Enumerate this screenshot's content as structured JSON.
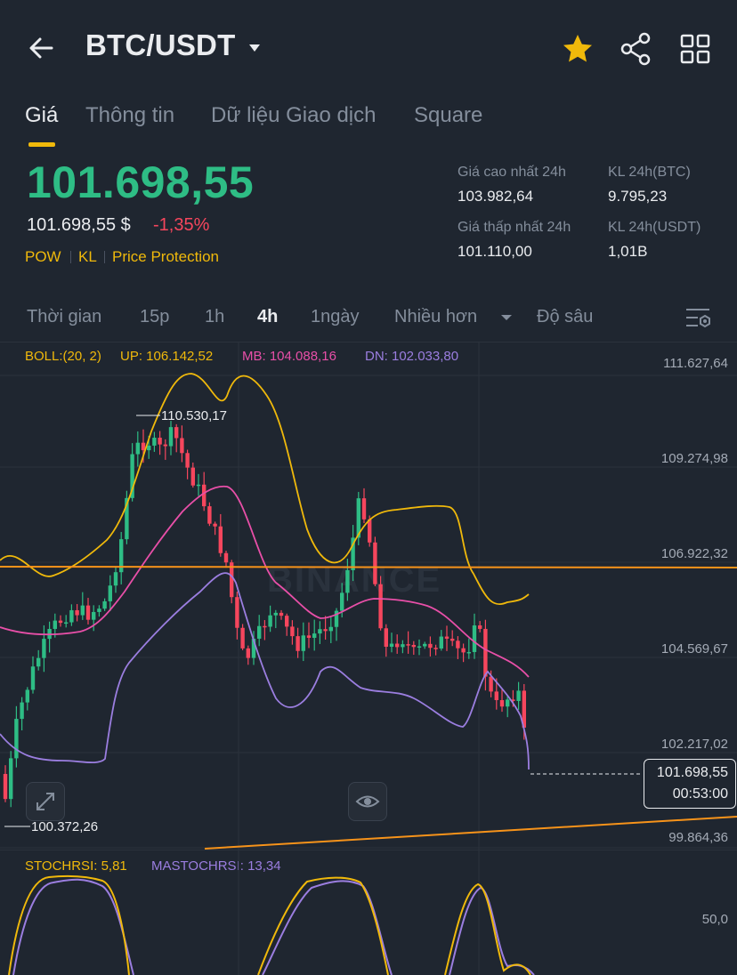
{
  "header": {
    "pair": "BTC/USDT",
    "icons": [
      "back-arrow-icon",
      "chevron-down-icon",
      "star-icon",
      "share-icon",
      "grid-icon"
    ],
    "colors": {
      "star": "#f0b90b"
    }
  },
  "tabs": [
    "Giá",
    "Thông tin",
    "Dữ liệu Giao dịch",
    "Square"
  ],
  "price": {
    "last": "101.698,55",
    "usd": "101.698,55 $",
    "change": "-1,35%",
    "tags": [
      "POW",
      "KL",
      "Price Protection"
    ],
    "colors": {
      "up": "#2ebd85",
      "down": "#f6465d",
      "tag": "#f0b90b"
    }
  },
  "stats": {
    "high_label": "Giá cao nhất 24h",
    "high_value": "103.982,64",
    "low_label": "Giá thấp nhất 24h",
    "low_value": "101.110,00",
    "vol_btc_label": "KL 24h(BTC)",
    "vol_btc_value": "9.795,23",
    "vol_usdt_label": "KL 24h(USDT)",
    "vol_usdt_value": "1,01B"
  },
  "intervals": {
    "items": [
      "Thời gian",
      "15p",
      "1h",
      "4h",
      "1ngày",
      "Nhiều hơn",
      "Độ sâu"
    ],
    "selected": "4h",
    "settings_icon": "chart-settings-icon"
  },
  "chart": {
    "boll_legend": {
      "label": "BOLL:(20, 2)",
      "up": "UP: 106.142,52",
      "mb": "MB: 104.088,16",
      "dn": "DN: 102.033,80"
    },
    "y_labels": [
      "111.627,64",
      "109.274,98",
      "106.922,32",
      "104.569,67",
      "102.217,02",
      "99.864,36"
    ],
    "max_annotation": "110.530,17",
    "min_annotation": "100.372,26",
    "last_price": "101.698,55",
    "countdown": "00:53:00",
    "watermark": "BINANCE",
    "icons": [
      "expand-icon",
      "eye-icon"
    ],
    "colors": {
      "up": "#2ebd85",
      "down": "#f6465d",
      "boll_up": "#f0b90b",
      "boll_mb": "#e84fa8",
      "boll_dn": "#9b7ee0",
      "trendline": "#f7931a"
    }
  },
  "stoch": {
    "stoch_label": "STOCHRSI: 5,81",
    "ma_label": "MASTOCHRSI: 13,34",
    "y_label": "50,0"
  }
}
